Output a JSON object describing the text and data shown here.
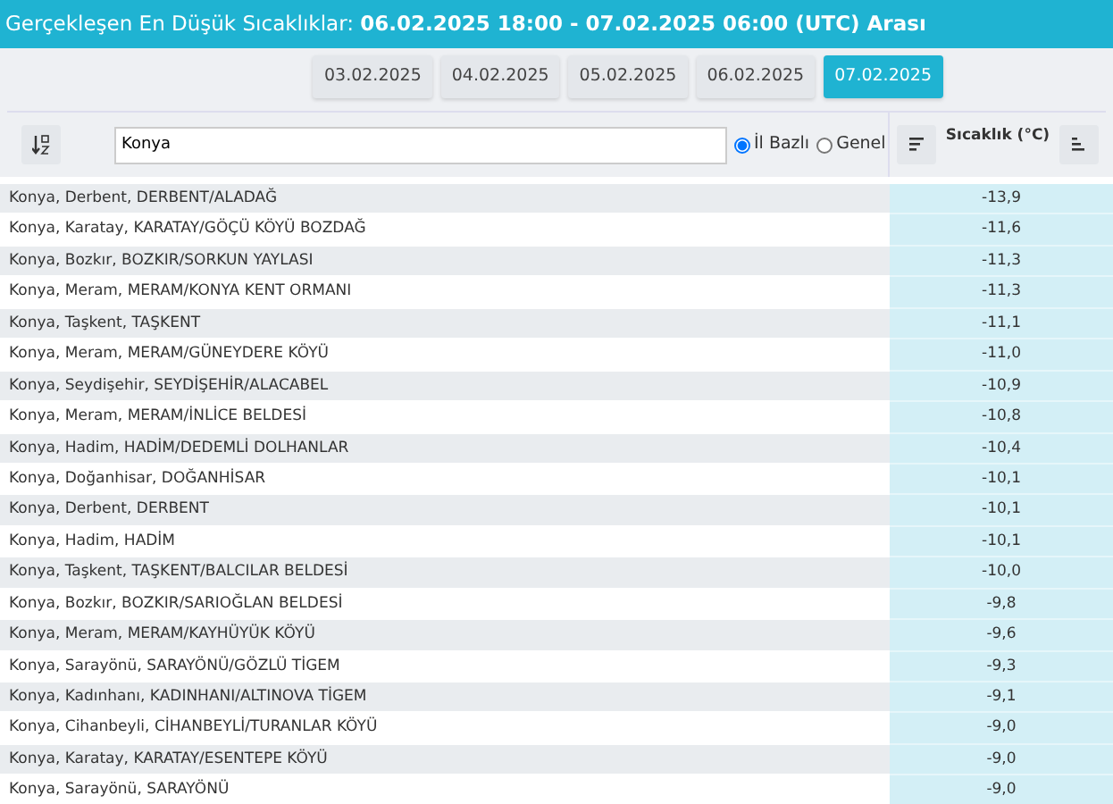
{
  "header": {
    "title": "Gerçekleşen En Düşük Sıcaklıklar: **06.02.2025 18:00 - 07.02.2025 06:00 (UTC) Arası**"
  },
  "date_tabs": [
    {
      "label": "03.02.2025",
      "selected": false
    },
    {
      "label": "04.02.2025",
      "selected": false
    },
    {
      "label": "05.02.2025",
      "selected": false
    },
    {
      "label": "06.02.2025",
      "selected": false
    },
    {
      "label": "07.02.2025",
      "selected": true
    }
  ],
  "search": {
    "value": "Konya"
  },
  "scope": [
    {
      "label": "İl Bazlı",
      "selected": true
    },
    {
      "label": "Genel",
      "selected": false
    }
  ],
  "temperature_column": {
    "heading": "Sıcaklık (°C)"
  },
  "rows": [
    {
      "station": "Konya, Derbent, DERBENT/ALADAĞ",
      "temperature": "-13,9"
    },
    {
      "station": "Konya, Karatay, KARATAY/GÖÇÜ KÖYÜ BOZDAĞ",
      "temperature": "-11,6"
    },
    {
      "station": "Konya, Bozkır, BOZKIR/SORKUN YAYLASI",
      "temperature": "-11,3"
    },
    {
      "station": "Konya, Meram, MERAM/KONYA KENT ORMANI",
      "temperature": "-11,3"
    },
    {
      "station": "Konya, Taşkent, TAŞKENT",
      "temperature": "-11,1"
    },
    {
      "station": "Konya, Meram, MERAM/GÜNEYDERE KÖYÜ",
      "temperature": "-11,0"
    },
    {
      "station": "Konya, Seydişehir, SEYDİŞEHİR/ALACABEL",
      "temperature": "-10,9"
    },
    {
      "station": "Konya, Meram, MERAM/İNLİCE BELDESİ",
      "temperature": "-10,8"
    },
    {
      "station": "Konya, Hadim, HADİM/DEDEMLİ DOLHANLAR",
      "temperature": "-10,4"
    },
    {
      "station": "Konya, Doğanhisar, DOĞANHİSAR",
      "temperature": "-10,1"
    },
    {
      "station": "Konya, Derbent, DERBENT",
      "temperature": "-10,1"
    },
    {
      "station": "Konya, Hadim, HADİM",
      "temperature": "-10,1"
    },
    {
      "station": "Konya, Taşkent, TAŞKENT/BALCILAR BELDESİ",
      "temperature": "-10,0"
    },
    {
      "station": "Konya, Bozkır, BOZKIR/SARIOĞLAN BELDESİ",
      "temperature": "-9,8"
    },
    {
      "station": "Konya, Meram, MERAM/KAYHÜYÜK KÖYÜ",
      "temperature": "-9,6"
    },
    {
      "station": "Konya, Sarayönü, SARAYÖNÜ/GÖZLÜ TİGEM",
      "temperature": "-9,3"
    },
    {
      "station": "Konya, Kadınhanı, KADINHANI/ALTINOVA TİGEM",
      "temperature": "-9,1"
    },
    {
      "station": "Konya, Cihanbeyli, CİHANBEYLİ/TURANLAR KÖYÜ",
      "temperature": "-9,0"
    },
    {
      "station": "Konya, Karatay, KARATAY/ESENTEPE KÖYÜ",
      "temperature": "-9,0"
    },
    {
      "station": "Konya, Sarayönü, SARAYÖNÜ",
      "temperature": "-9,0"
    }
  ]
}
